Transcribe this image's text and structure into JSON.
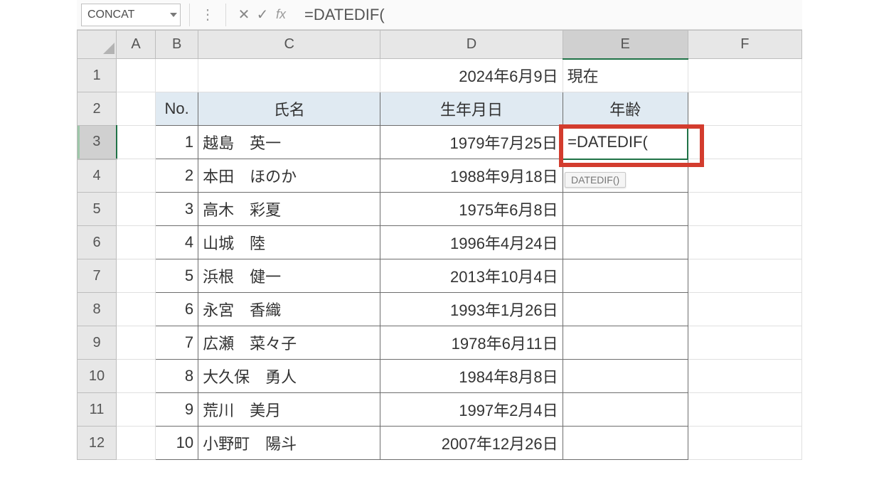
{
  "formula_bar": {
    "cell_ref": "CONCAT",
    "formula": "=DATEDIF("
  },
  "columns": [
    "A",
    "B",
    "C",
    "D",
    "E",
    "F"
  ],
  "rows": [
    "1",
    "2",
    "3",
    "4",
    "5",
    "6",
    "7",
    "8",
    "9",
    "10",
    "11",
    "12"
  ],
  "row1": {
    "D": "2024年6月9日",
    "E": "現在"
  },
  "headers": {
    "B": "No.",
    "C": "氏名",
    "D": "生年月日",
    "E": "年齢"
  },
  "editing": {
    "formula": "=DATEDIF(",
    "tooltip": "DATEDIF()"
  },
  "people": [
    {
      "no": "1",
      "name": "越島　英一",
      "birth": "1979年7月25日"
    },
    {
      "no": "2",
      "name": "本田　ほのか",
      "birth": "1988年9月18日"
    },
    {
      "no": "3",
      "name": "高木　彩夏",
      "birth": "1975年6月8日"
    },
    {
      "no": "4",
      "name": "山城　陸",
      "birth": "1996年4月24日"
    },
    {
      "no": "5",
      "name": "浜根　健一",
      "birth": "2013年10月4日"
    },
    {
      "no": "6",
      "name": "永宮　香織",
      "birth": "1993年1月26日"
    },
    {
      "no": "7",
      "name": "広瀬　菜々子",
      "birth": "1978年6月11日"
    },
    {
      "no": "8",
      "name": "大久保　勇人",
      "birth": "1984年8月8日"
    },
    {
      "no": "9",
      "name": "荒川　美月",
      "birth": "1997年2月4日"
    },
    {
      "no": "10",
      "name": "小野町　陽斗",
      "birth": "2007年12月26日"
    }
  ]
}
